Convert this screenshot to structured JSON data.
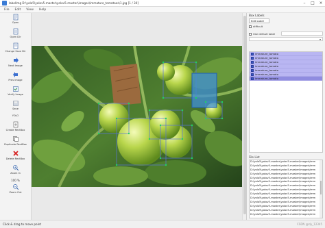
{
  "window": {
    "title": "labelImg D:\\yolo5\\yolov5-master\\yolov5-master\\images\\immature_tomatoes\\1.jpg [1 / 30]"
  },
  "menu": [
    "File",
    "Edit",
    "View",
    "Help"
  ],
  "toolbar": {
    "open": "Open",
    "open_dir": "Open Dir",
    "change_save_dir": "Change Save Dir",
    "next_image": "Next Image",
    "prev_image": "Prev Image",
    "verify_image": "Verify Image",
    "save": "Save",
    "save_format": "YOLO",
    "create_rectbox": "Create RectBox",
    "duplicate_rectbox": "Duplicate RectBox",
    "delete_rectbox": "Delete RectBox",
    "zoom_in": "Zoom In",
    "zoom_value": "100 %",
    "zoom_out": "Zoom Out"
  },
  "box_labels": {
    "title": "Box Labels",
    "edit_label": "Edit Label",
    "difficult": "difficult",
    "use_default_label": "Use default label",
    "labels": [
      "immature_tomato",
      "immature_tomato",
      "immature_tomato",
      "immature_tomato",
      "immature_tomato",
      "immature_tomato",
      "immature_tomato"
    ]
  },
  "file_list": {
    "title": "File List",
    "files": [
      "D:\\yolo5\\yolov5-master\\yolov5-master\\images\\imm",
      "D:\\yolo5\\yolov5-master\\yolov5-master\\images\\imm",
      "D:\\yolo5\\yolov5-master\\yolov5-master\\images\\imm",
      "D:\\yolo5\\yolov5-master\\yolov5-master\\images\\imm",
      "D:\\yolo5\\yolov5-master\\yolov5-master\\images\\imm",
      "D:\\yolo5\\yolov5-master\\yolov5-master\\images\\imm",
      "D:\\yolo5\\yolov5-master\\yolov5-master\\images\\imm",
      "D:\\yolo5\\yolov5-master\\yolov5-master\\images\\imm",
      "D:\\yolo5\\yolov5-master\\yolov5-master\\images\\imm",
      "D:\\yolo5\\yolov5-master\\yolov5-master\\images\\imm",
      "D:\\yolo5\\yolov5-master\\yolov5-master\\images\\imm",
      "D:\\yolo5\\yolov5-master\\yolov5-master\\images\\imm",
      "D:\\yolo5\\yolov5-master\\yolov5-master\\images\\imm",
      "D:\\yolo5\\yolov5-master\\yolov5-master\\images\\imm"
    ]
  },
  "status": {
    "text": "Click & drag to move point",
    "watermark": "CSDN @zly_12345"
  },
  "colors": {
    "label_row": "#b9b6f2",
    "selected_box": "#3f8fd8"
  }
}
